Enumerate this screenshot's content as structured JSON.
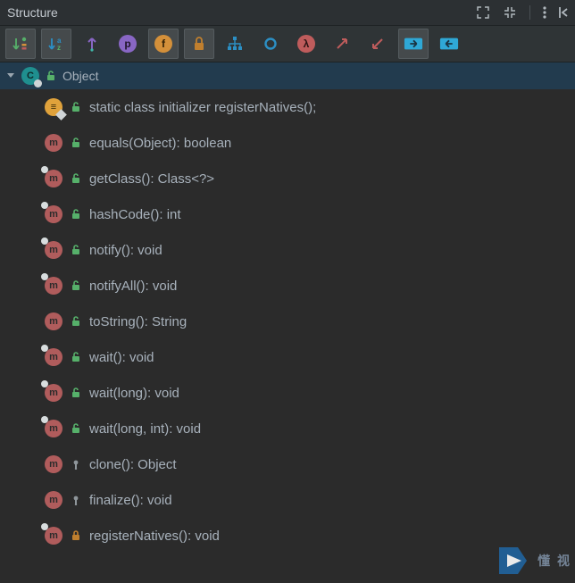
{
  "panel": {
    "title": "Structure"
  },
  "colors": {
    "green": "#56b06a",
    "teal": "#3fb5a7",
    "purple": "#8866c4",
    "orange": "#d4903a",
    "orangeDark": "#c07f2e",
    "blue": "#2c8fc4",
    "red": "#bf5c5c",
    "accent": "#2fa8d6"
  },
  "toolbar": {
    "items": [
      {
        "id": "sort-visibility",
        "active": true
      },
      {
        "id": "sort-alpha",
        "active": true
      },
      {
        "id": "show-inherited",
        "active": false
      },
      {
        "id": "show-properties",
        "active": false
      },
      {
        "id": "show-fields",
        "active": true
      },
      {
        "id": "show-nonpublic",
        "active": true
      },
      {
        "id": "show-structure",
        "active": false
      },
      {
        "id": "show-circle",
        "active": false
      },
      {
        "id": "show-lambdas",
        "active": false
      },
      {
        "id": "expand-all",
        "active": false
      },
      {
        "id": "collapse-all",
        "active": false
      },
      {
        "id": "autoscroll-to",
        "active": true
      },
      {
        "id": "autoscroll-from",
        "active": false
      }
    ]
  },
  "root": {
    "label": "Object"
  },
  "members": [
    {
      "kind": "initializer",
      "vis": "public",
      "native": false,
      "sig": "static class initializer  registerNatives();"
    },
    {
      "kind": "method",
      "vis": "public",
      "native": false,
      "sig": "equals(Object): boolean"
    },
    {
      "kind": "method",
      "vis": "public",
      "native": true,
      "sig": "getClass(): Class<?>"
    },
    {
      "kind": "method",
      "vis": "public",
      "native": true,
      "sig": "hashCode(): int"
    },
    {
      "kind": "method",
      "vis": "public",
      "native": true,
      "sig": "notify(): void"
    },
    {
      "kind": "method",
      "vis": "public",
      "native": true,
      "sig": "notifyAll(): void"
    },
    {
      "kind": "method",
      "vis": "public",
      "native": false,
      "sig": "toString(): String"
    },
    {
      "kind": "method",
      "vis": "public",
      "native": true,
      "sig": "wait(): void"
    },
    {
      "kind": "method",
      "vis": "public",
      "native": true,
      "sig": "wait(long): void"
    },
    {
      "kind": "method",
      "vis": "public",
      "native": true,
      "sig": "wait(long, int): void"
    },
    {
      "kind": "method",
      "vis": "protected",
      "native": false,
      "sig": "clone(): Object"
    },
    {
      "kind": "method",
      "vis": "protected",
      "native": false,
      "sig": "finalize(): void"
    },
    {
      "kind": "method",
      "vis": "private",
      "native": true,
      "sig": "registerNatives(): void"
    }
  ],
  "watermark": {
    "text": "懂 视"
  }
}
